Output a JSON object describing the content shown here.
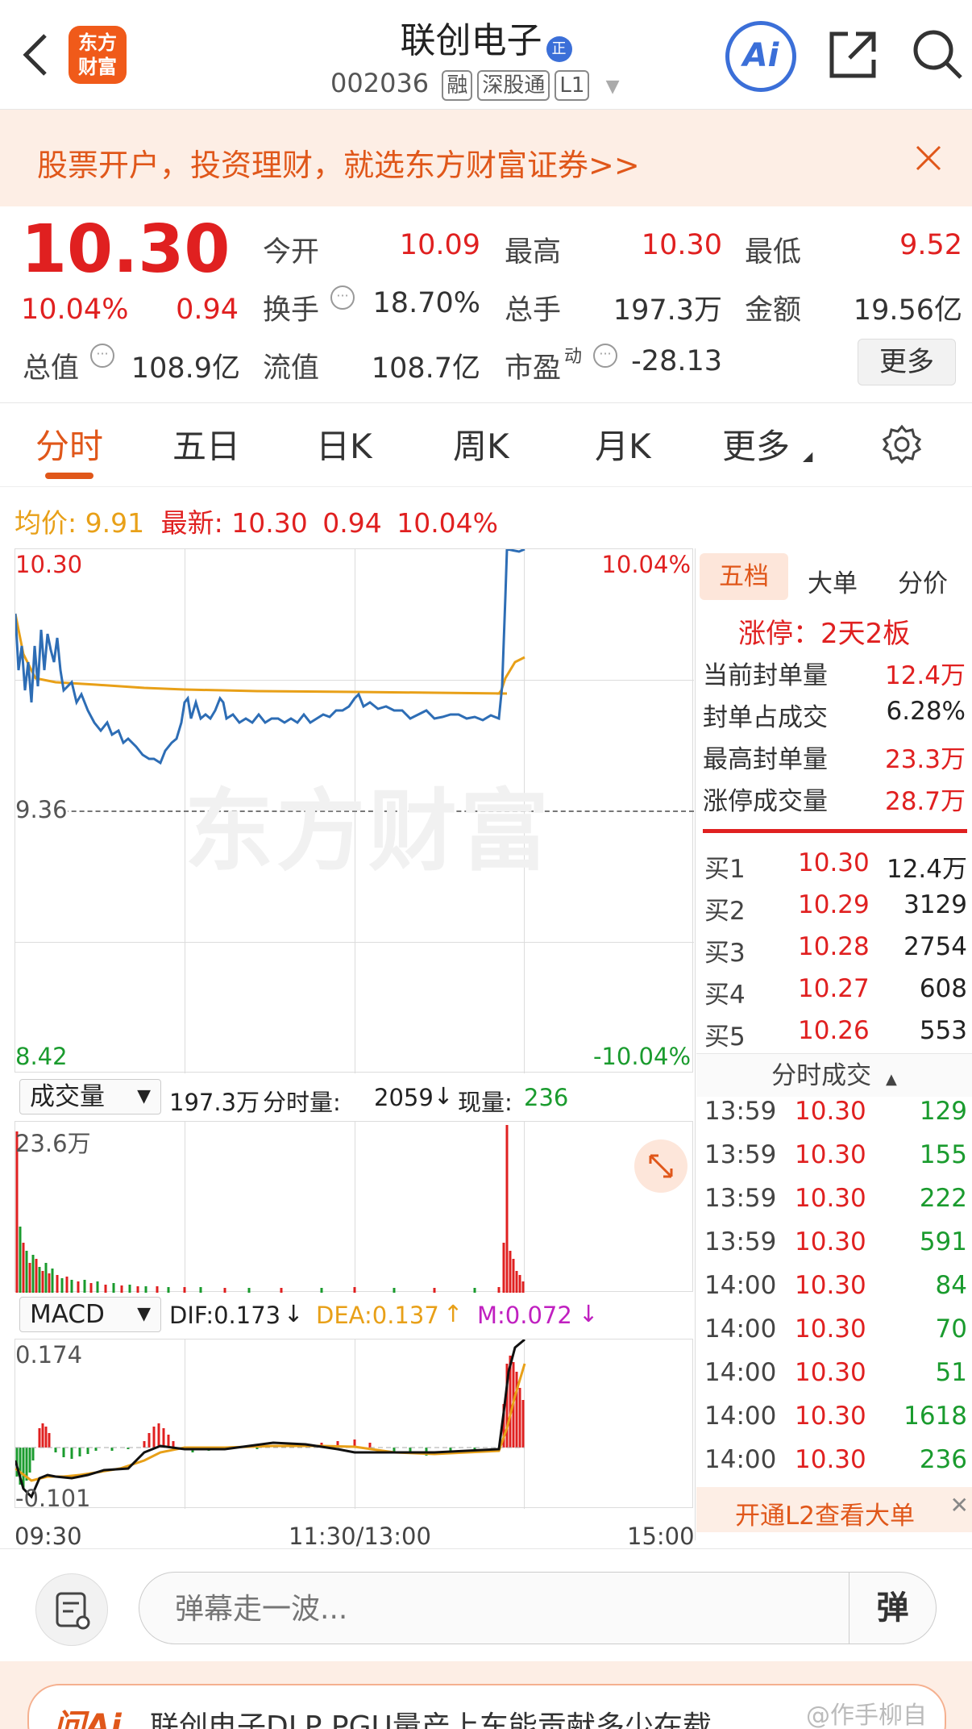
{
  "header": {
    "back_icon": "chevron-left-icon",
    "app_logo_text": "东方财富",
    "stock_name": "联创电子",
    "name_badge": "正",
    "stock_code": "002036",
    "tags": [
      "融",
      "深股通",
      "L1"
    ],
    "ai_label": "Ai",
    "share_icon": "share-icon",
    "search_icon": "search-icon"
  },
  "banner": {
    "text": "股票开户，投资理财，就选东方财富证券>>",
    "close_icon": "close-icon"
  },
  "quote": {
    "price": "10.30",
    "change_pct": "10.04%",
    "change": "0.94",
    "open_label": "今开",
    "open": "10.09",
    "high_label": "最高",
    "high": "10.30",
    "low_label": "最低",
    "low": "9.52",
    "turnover_label": "换手",
    "turnover": "18.70%",
    "volume_label": "总手",
    "volume": "197.3万",
    "amount_label": "金额",
    "amount": "19.56亿",
    "mktcap_label": "总值",
    "mktcap": "108.9亿",
    "float_label": "流值",
    "float_cap": "108.7亿",
    "pe_label": "市盈",
    "pe_sup": "动",
    "pe": "-28.13",
    "more_button": "更多"
  },
  "tabs": [
    "分时",
    "五日",
    "日K",
    "周K",
    "月K",
    "更多"
  ],
  "settings_icon": "gear-icon",
  "chart_info": {
    "avg_label": "均价:",
    "avg": "9.91",
    "last_label": "最新:",
    "last": "10.30",
    "last_chg": "0.94",
    "last_pct": "10.04%"
  },
  "price_axis": {
    "top_price": "10.30",
    "top_pct": "10.04%",
    "mid_price": "9.36",
    "bottom_price": "8.42",
    "bottom_pct": "-10.04%"
  },
  "watermark": "东方财富",
  "volume_panel": {
    "selector": "成交量",
    "total": "197.3万",
    "min_vol_label": "分时量:",
    "min_vol": "2059",
    "cur_vol_label": "现量:",
    "cur_vol": "236",
    "max_label": "23.6万"
  },
  "macd_panel": {
    "selector": "MACD",
    "dif": "DIF:0.173",
    "dea": "DEA:0.137",
    "m": "M:0.072",
    "top": "0.174",
    "bottom": "-0.101"
  },
  "time_axis": [
    "09:30",
    "11:30/13:00",
    "15:00"
  ],
  "right_panel": {
    "tabs": [
      "五档",
      "大单",
      "分价"
    ],
    "limit_title": "涨停：2天2板",
    "stats": [
      {
        "label": "当前封单量",
        "value": "12.4万"
      },
      {
        "label": "封单占成交",
        "value": "6.28%"
      },
      {
        "label": "最高封单量",
        "value": "23.3万"
      },
      {
        "label": "涨停成交量",
        "value": "28.7万"
      }
    ],
    "bids": [
      {
        "label": "买1",
        "price": "10.30",
        "vol": "12.4万"
      },
      {
        "label": "买2",
        "price": "10.29",
        "vol": "3129"
      },
      {
        "label": "买3",
        "price": "10.28",
        "vol": "2754"
      },
      {
        "label": "买4",
        "price": "10.27",
        "vol": "608"
      },
      {
        "label": "买5",
        "price": "10.26",
        "vol": "553"
      }
    ],
    "trades_title": "分时成交",
    "trades": [
      {
        "time": "13:59",
        "price": "10.30",
        "vol": "129"
      },
      {
        "time": "13:59",
        "price": "10.30",
        "vol": "155"
      },
      {
        "time": "13:59",
        "price": "10.30",
        "vol": "222"
      },
      {
        "time": "13:59",
        "price": "10.30",
        "vol": "591"
      },
      {
        "time": "14:00",
        "price": "10.30",
        "vol": "84"
      },
      {
        "time": "14:00",
        "price": "10.30",
        "vol": "70"
      },
      {
        "time": "14:00",
        "price": "10.30",
        "vol": "51"
      },
      {
        "time": "14:00",
        "price": "10.30",
        "vol": "1618"
      },
      {
        "time": "14:00",
        "price": "10.30",
        "vol": "236"
      }
    ],
    "l2_text": "开通L2查看大单"
  },
  "comment_bar": {
    "placeholder": "弹幕走一波...",
    "danmaku_label": "弹"
  },
  "bottom_card": {
    "text": "联创电子DLP PGU量产上车能贡献多少在载"
  },
  "weibo_watermark": "@作手柳自",
  "colors": {
    "up": "#e02020",
    "down": "#1a9b2e",
    "avg_line": "#e8a018",
    "price_line": "#2d6db5",
    "brand": "#f05a1a"
  }
}
